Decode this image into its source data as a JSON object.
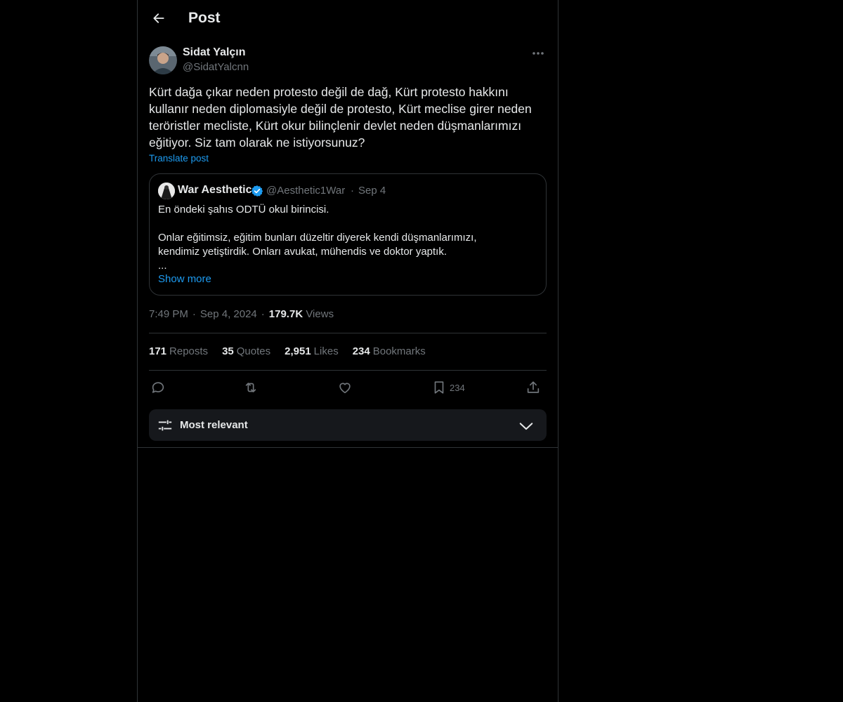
{
  "header": {
    "back_icon": "arrow-left-icon",
    "title": "Post"
  },
  "post": {
    "author": {
      "name": "Sidat Yalçın",
      "handle": "@SidatYalcnn"
    },
    "text": "Kürt dağa çıkar neden protesto değil de dağ, Kürt protesto hakkını kullanır neden diplomasiyle değil de protesto, Kürt meclise girer neden teröristler mecliste, Kürt okur bilinçlenir devlet neden düşmanlarımızı eğitiyor. Siz tam olarak ne istiyorsunuz?",
    "translate_label": "Translate post",
    "quote": {
      "name": "War Aesthetic",
      "handle": "@Aesthetic1War",
      "dot": "·",
      "date": "Sep 4",
      "lines": [
        "En öndeki şahıs ODTÜ okul birincisi.",
        "",
        "Onlar eğitimsiz, eğitim bunları düzeltir diyerek kendi düşmanlarımızı,",
        "kendimiz yetiştirdik. Onları avukat, mühendis ve doktor yaptık.",
        "..."
      ],
      "show_more": "Show more"
    },
    "meta": {
      "time": "7:49 PM",
      "dot1": "·",
      "date": "Sep 4, 2024",
      "dot2": "·",
      "views_count": "179.7K",
      "views_label": "Views"
    },
    "stats": {
      "reposts_count": "171",
      "reposts_label": "Reposts",
      "quotes_count": "35",
      "quotes_label": "Quotes",
      "likes_count": "2,951",
      "likes_label": "Likes",
      "bookmarks_count": "234",
      "bookmarks_label": "Bookmarks"
    },
    "actions": {
      "reply_icon": "reply-icon",
      "repost_icon": "repost-icon",
      "like_icon": "heart-icon",
      "bookmark_icon": "bookmark-icon",
      "bookmark_count": "234",
      "share_icon": "share-icon"
    }
  },
  "sort": {
    "icon": "sliders-icon",
    "label": "Most relevant",
    "chevron_icon": "chevron-down-icon"
  },
  "colors": {
    "background": "#000000",
    "text": "#e7e9ea",
    "secondary": "#71767b",
    "accent": "#1d9bf0",
    "border": "#2f3336"
  }
}
